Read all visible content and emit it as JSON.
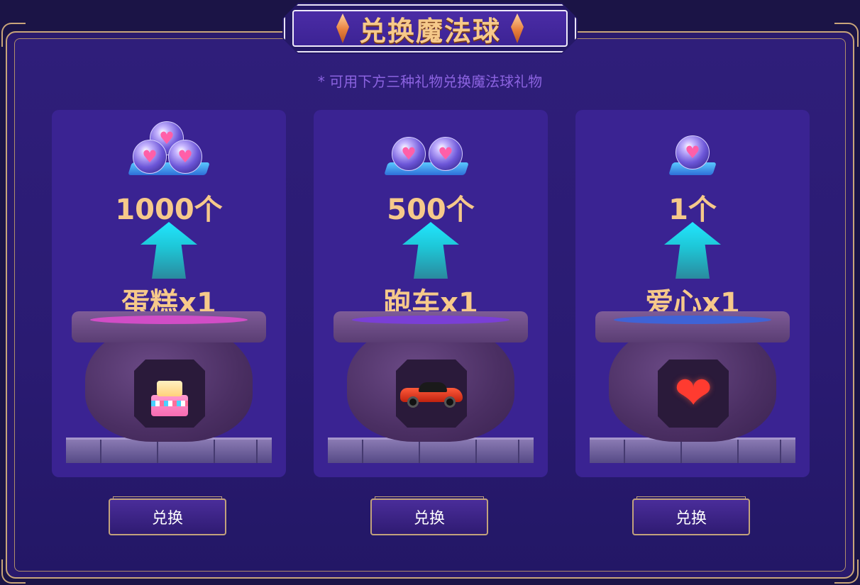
{
  "title": "兑换魔法球",
  "subtitle": "* 可用下方三种礼物兑换魔法球礼物",
  "colors": {
    "background": "#2a1b72",
    "card": "#3a2392",
    "gold_text": "#f6c98a",
    "subtitle": "#8b63e0",
    "arrow": "#22e6ff",
    "border_gold": "#c9a57a"
  },
  "cards": [
    {
      "orb_count": "1000个",
      "gift_label": "蛋糕x1",
      "gift_icon": "birthday-cake-icon",
      "liquid_color": "#d14dc6",
      "button_label": "兑换"
    },
    {
      "orb_count": "500个",
      "gift_label": "跑车x1",
      "gift_icon": "sports-car-icon",
      "liquid_color": "#7a3fd6",
      "button_label": "兑换"
    },
    {
      "orb_count": "1个",
      "gift_label": "爱心x1",
      "gift_icon": "heart-icon",
      "liquid_color": "#3f63d6",
      "button_label": "兑换"
    }
  ],
  "icons": {
    "orb": "magic-orb-icon",
    "arrow": "up-arrow-icon",
    "cauldron": "cauldron-icon",
    "crystal": "crystal-icon"
  }
}
